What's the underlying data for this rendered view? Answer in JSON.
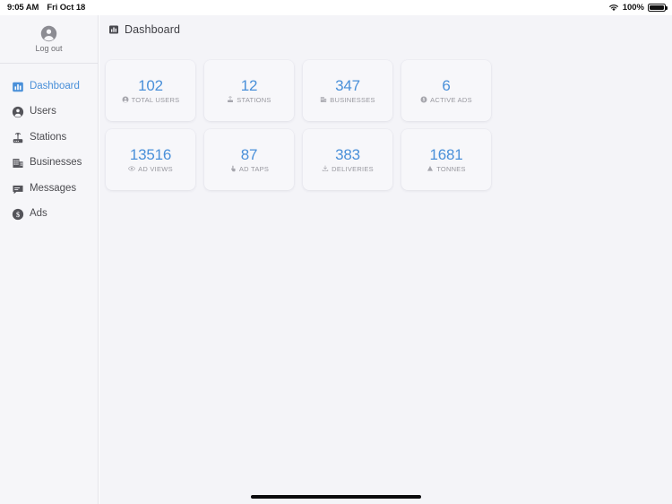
{
  "statusbar": {
    "time": "9:05 AM",
    "date": "Fri Oct 18",
    "battery_percent": "100%",
    "wifi_icon": "wifi-icon",
    "battery_icon": "battery-full-icon"
  },
  "sidebar": {
    "account": {
      "icon": "account-circle-icon",
      "logout_label": "Log out"
    },
    "items": [
      {
        "label": "Dashboard",
        "icon": "bar-chart-icon",
        "active": true,
        "key": "dashboard"
      },
      {
        "label": "Users",
        "icon": "person-circle-icon",
        "active": false,
        "key": "users"
      },
      {
        "label": "Stations",
        "icon": "station-router-icon",
        "active": false,
        "key": "stations"
      },
      {
        "label": "Businesses",
        "icon": "office-building-icon",
        "active": false,
        "key": "businesses"
      },
      {
        "label": "Messages",
        "icon": "chat-bubble-icon",
        "active": false,
        "key": "messages"
      },
      {
        "label": "Ads",
        "icon": "dollar-circle-icon",
        "active": false,
        "key": "ads"
      }
    ]
  },
  "header": {
    "icon": "bar-chart-icon",
    "title": "Dashboard"
  },
  "stats": {
    "rows": [
      [
        {
          "value": "102",
          "label": "TOTAL USERS",
          "icon": "person-circle-icon"
        },
        {
          "value": "12",
          "label": "STATIONS",
          "icon": "station-router-icon"
        },
        {
          "value": "347",
          "label": "BUSINESSES",
          "icon": "office-building-icon"
        },
        {
          "value": "6",
          "label": "ACTIVE ADS",
          "icon": "dollar-circle-icon"
        }
      ],
      [
        {
          "value": "13516",
          "label": "AD VIEWS",
          "icon": "eye-icon"
        },
        {
          "value": "87",
          "label": "AD TAPS",
          "icon": "tap-hand-icon"
        },
        {
          "value": "383",
          "label": "DELIVERIES",
          "icon": "delivery-drop-icon"
        },
        {
          "value": "1681",
          "label": "TONNES",
          "icon": "cone-weight-icon"
        }
      ]
    ]
  },
  "colors": {
    "accent_blue": "#4a90d9",
    "card_bg": "#f7f7fa",
    "sidebar_bg": "#f6f6f9",
    "main_bg": "#f4f4f8",
    "text_primary": "#3e3e44",
    "text_muted": "#98989f"
  },
  "home_indicator": {
    "name": "home-indicator"
  }
}
